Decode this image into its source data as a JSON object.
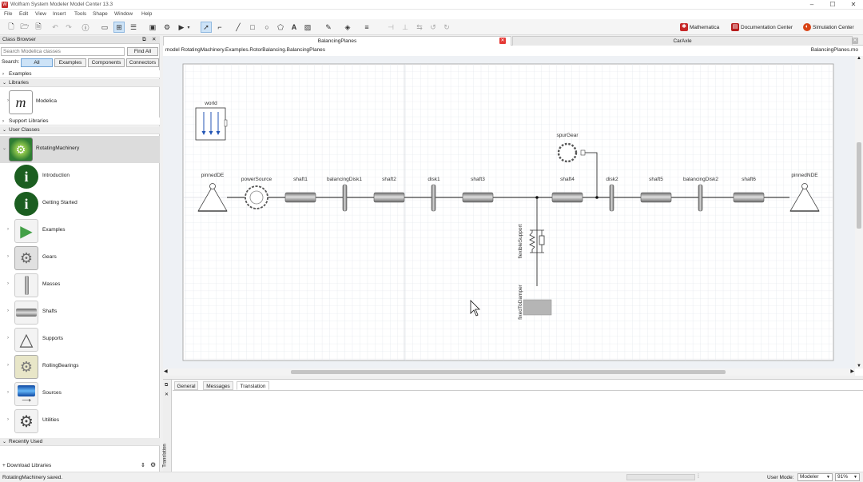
{
  "app": {
    "title": "Wolfram System Modeler Model Center 13.3"
  },
  "menu": {
    "items": [
      "File",
      "Edit",
      "View",
      "Insert",
      "Tools",
      "Shape",
      "Window",
      "Help"
    ]
  },
  "toolbar": {
    "mathematica": "Mathematica",
    "documentation": "Documentation Center",
    "simulation": "Simulation Center"
  },
  "class_browser": {
    "title": "Class Browser",
    "search_placeholder": "Search Modelica classes",
    "find_all": "Find All",
    "search_label": "Search:",
    "filters": [
      "All",
      "Examples",
      "Components",
      "Connectors"
    ],
    "sections": {
      "examples": "Examples",
      "libraries": "Libraries",
      "support": "Support Libraries",
      "user": "User Classes",
      "recent": "Recently Used"
    },
    "libraries": [
      {
        "label": "Modelica"
      }
    ],
    "user_classes": [
      {
        "label": "RotatingMachinery"
      },
      {
        "label": "Introduction"
      },
      {
        "label": "Getting Started"
      },
      {
        "label": "Examples"
      },
      {
        "label": "Gears"
      },
      {
        "label": "Masses"
      },
      {
        "label": "Shafts"
      },
      {
        "label": "Supports"
      },
      {
        "label": "RollingBearings"
      },
      {
        "label": "Sources"
      },
      {
        "label": "Utilities"
      }
    ],
    "download": "Download Libraries"
  },
  "editor": {
    "tabs": [
      {
        "label": "BalancingPlanes"
      },
      {
        "label": "CarAxle"
      }
    ],
    "model_path": "model RotatingMachinery.Examples.RotorBalancing.BalancingPlanes",
    "file_name": "BalancingPlanes.mo",
    "components": {
      "world": "world",
      "pinnedDE": "pinnedDE",
      "powerSource": "powerSource",
      "shaft1": "shaft1",
      "balancingDisk1": "balancingDisk1",
      "shaft2": "shaft2",
      "disk1": "disk1",
      "shaft3": "shaft3",
      "spurGear": "spurGear",
      "shaft4": "shaft4",
      "disk2": "disk2",
      "shaft5": "shaft5",
      "balancingDisk2": "balancingDisk2",
      "shaft6": "shaft6",
      "pinnedNDE": "pinnedNDE",
      "flexibleSupport": "flexibleSupport",
      "fixedToDamper": "fixedToDamper"
    }
  },
  "bottom": {
    "tabs": [
      "General",
      "Messages",
      "Translation"
    ],
    "active_tab": "Translation",
    "side_label": "Translation"
  },
  "status": {
    "message": "RotatingMachinery saved.",
    "user_mode_label": "User Mode:",
    "user_mode": "Modeler",
    "zoom": "91%"
  },
  "colors": {
    "accent": "#1e6fb8",
    "selected": "#cde3f7",
    "wolfram_red": "#c62828"
  }
}
